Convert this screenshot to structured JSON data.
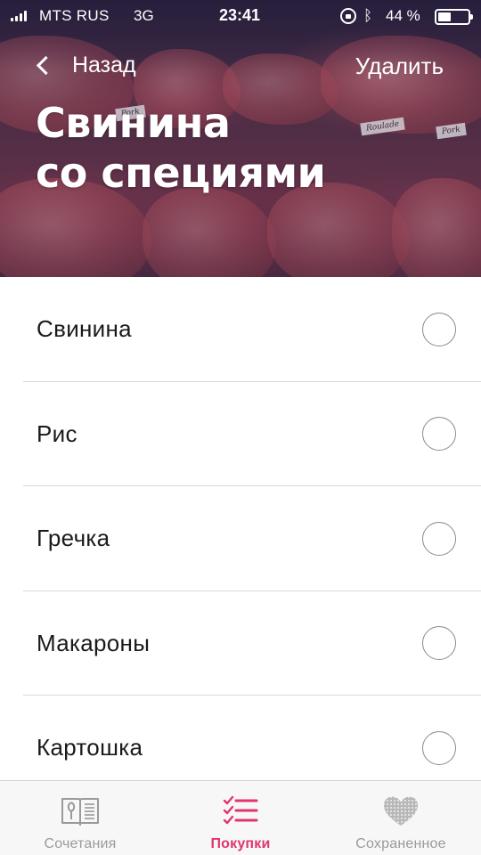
{
  "status_bar": {
    "carrier": "MTS RUS",
    "network": "3G",
    "time": "23:41",
    "battery": "44 %",
    "icons": [
      "signal-icon",
      "orientation-lock-icon",
      "bluetooth-icon",
      "battery-icon"
    ]
  },
  "nav": {
    "back_label": "Назад",
    "delete_label": "Удалить"
  },
  "header": {
    "title_line1": "Свинина",
    "title_line2": "со специями",
    "background": "meat-counter-photo"
  },
  "items": [
    {
      "label": "Свинина",
      "checked": false
    },
    {
      "label": "Рис",
      "checked": false
    },
    {
      "label": "Гречка",
      "checked": false
    },
    {
      "label": "Макароны",
      "checked": false
    },
    {
      "label": "Картошка",
      "checked": false
    }
  ],
  "tabs": [
    {
      "label": "Сочетания",
      "icon": "recipe-book-icon",
      "active": false
    },
    {
      "label": "Покупки",
      "icon": "checklist-icon",
      "active": true
    },
    {
      "label": "Сохраненное",
      "icon": "heart-icon",
      "active": false
    }
  ],
  "colors": {
    "accent": "#e0356f",
    "tab_inactive": "#9a9a9a",
    "divider": "#d8d8d8"
  }
}
